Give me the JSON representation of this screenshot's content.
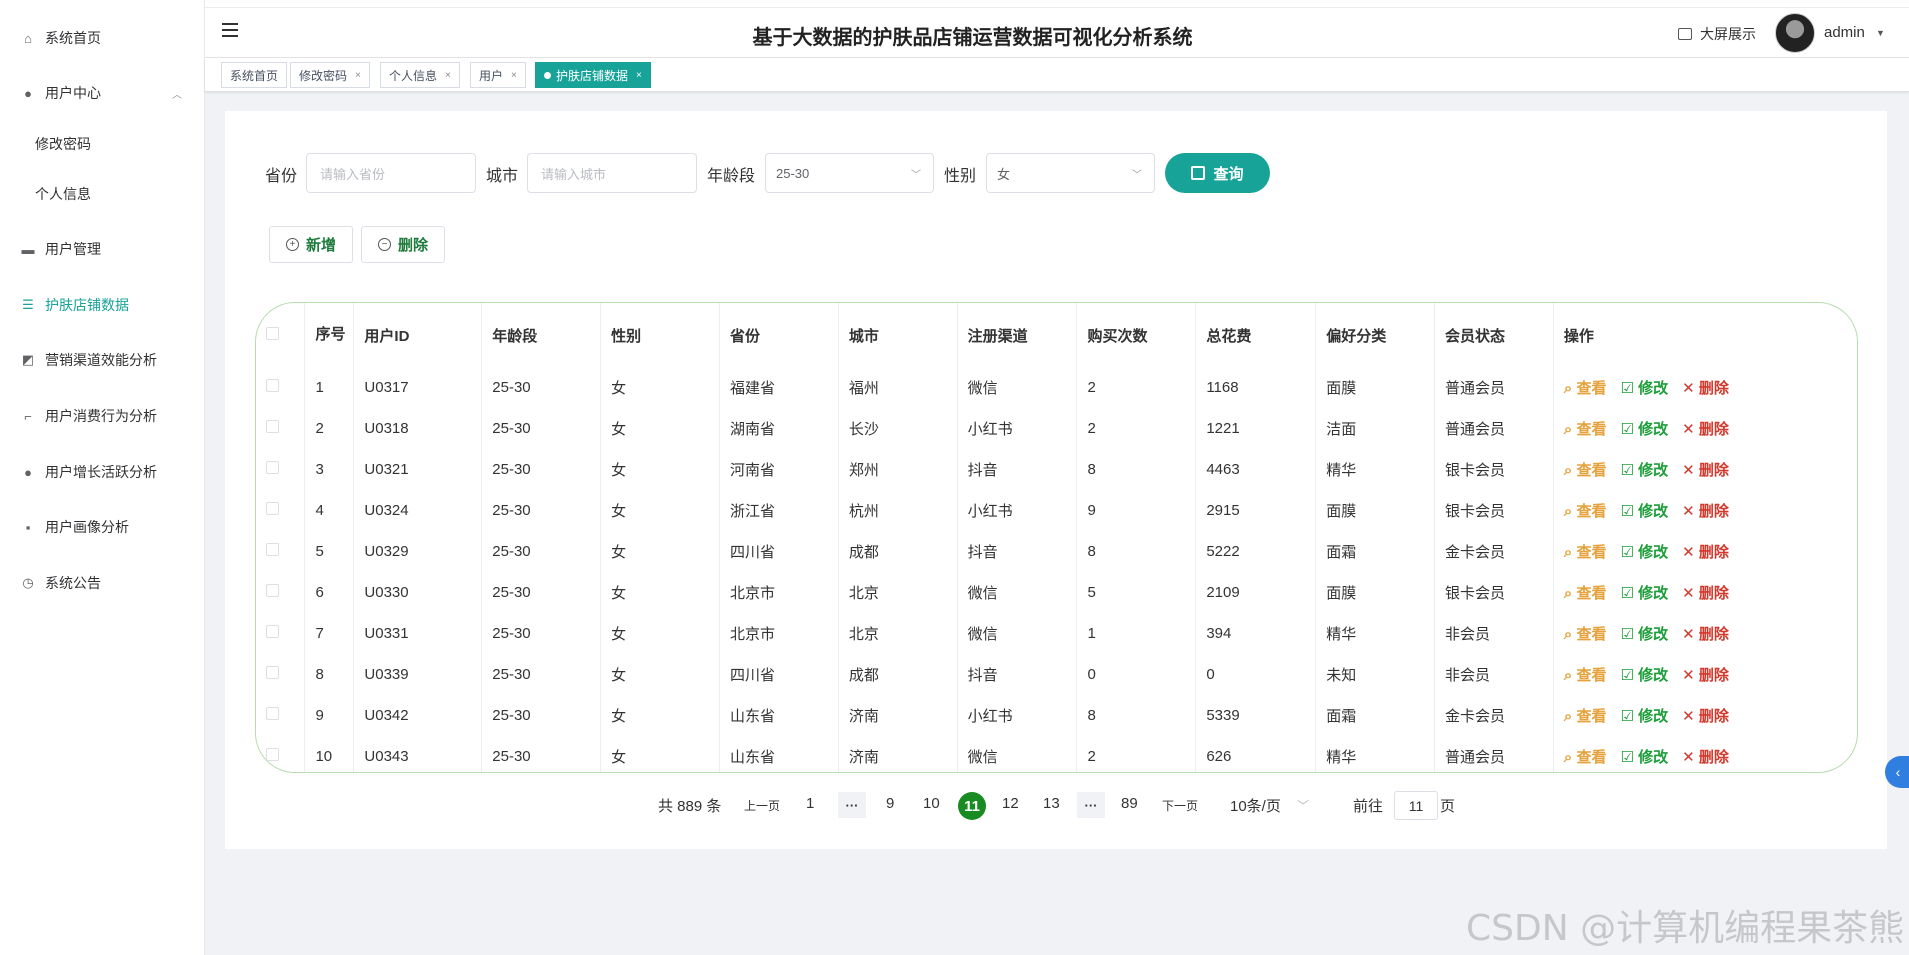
{
  "app": {
    "title": "基于大数据的护肤品店铺运营数据可视化分析系统",
    "big_screen": "大屏展示",
    "username": "admin"
  },
  "sidebar": {
    "home": "系统首页",
    "user_center": "用户中心",
    "change_password": "修改密码",
    "personal_info": "个人信息",
    "user_management": "用户管理",
    "skincare_data": "护肤店铺数据",
    "channel_analysis": "营销渠道效能分析",
    "consumption_analysis": "用户消费行为分析",
    "growth_analysis": "用户增长活跃分析",
    "portrait_analysis": "用户画像分析",
    "announcement": "系统公告"
  },
  "tabs": [
    "系统首页",
    "修改密码",
    "个人信息",
    "用户",
    "护肤店铺数据"
  ],
  "search": {
    "province_label": "省份",
    "province_placeholder": "请输入省份",
    "city_label": "城市",
    "city_placeholder": "请输入城市",
    "age_label": "年龄段",
    "age_value": "25-30",
    "gender_label": "性别",
    "gender_value": "女",
    "query_button": "查询"
  },
  "actions": {
    "add": "新增",
    "delete": "删除"
  },
  "table": {
    "headers": [
      "序号",
      "用户ID",
      "年龄段",
      "性别",
      "省份",
      "城市",
      "注册渠道",
      "购买次数",
      "总花费",
      "偏好分类",
      "会员状态",
      "操作"
    ],
    "row_actions": {
      "view": "查看",
      "edit": "修改",
      "delete": "删除"
    },
    "rows": [
      [
        "1",
        "U0317",
        "25-30",
        "女",
        "福建省",
        "福州",
        "微信",
        "2",
        "1168",
        "面膜",
        "普通会员"
      ],
      [
        "2",
        "U0318",
        "25-30",
        "女",
        "湖南省",
        "长沙",
        "小红书",
        "2",
        "1221",
        "洁面",
        "普通会员"
      ],
      [
        "3",
        "U0321",
        "25-30",
        "女",
        "河南省",
        "郑州",
        "抖音",
        "8",
        "4463",
        "精华",
        "银卡会员"
      ],
      [
        "4",
        "U0324",
        "25-30",
        "女",
        "浙江省",
        "杭州",
        "小红书",
        "9",
        "2915",
        "面膜",
        "银卡会员"
      ],
      [
        "5",
        "U0329",
        "25-30",
        "女",
        "四川省",
        "成都",
        "抖音",
        "8",
        "5222",
        "面霜",
        "金卡会员"
      ],
      [
        "6",
        "U0330",
        "25-30",
        "女",
        "北京市",
        "北京",
        "微信",
        "5",
        "2109",
        "面膜",
        "银卡会员"
      ],
      [
        "7",
        "U0331",
        "25-30",
        "女",
        "北京市",
        "北京",
        "微信",
        "1",
        "394",
        "精华",
        "非会员"
      ],
      [
        "8",
        "U0339",
        "25-30",
        "女",
        "四川省",
        "成都",
        "抖音",
        "0",
        "0",
        "未知",
        "非会员"
      ],
      [
        "9",
        "U0342",
        "25-30",
        "女",
        "山东省",
        "济南",
        "小红书",
        "8",
        "5339",
        "面霜",
        "金卡会员"
      ],
      [
        "10",
        "U0343",
        "25-30",
        "女",
        "山东省",
        "济南",
        "微信",
        "2",
        "626",
        "精华",
        "普通会员"
      ]
    ]
  },
  "pagination": {
    "total": "共 889 条",
    "prev": "上一页",
    "next": "下一页",
    "pages": [
      "1",
      "9",
      "10",
      "11",
      "12",
      "13",
      "89"
    ],
    "current": "11",
    "more": "···",
    "page_size": "10条/页",
    "goto_label": "前往",
    "goto_value": "11",
    "goto_suffix": "页"
  },
  "watermark": "CSDN @计算机编程果茶熊",
  "colors": {
    "accent": "#17a398",
    "current_page": "#188c22",
    "view": "#e6a23c",
    "edit": "#1e9e3a",
    "delete": "#d3382c"
  }
}
